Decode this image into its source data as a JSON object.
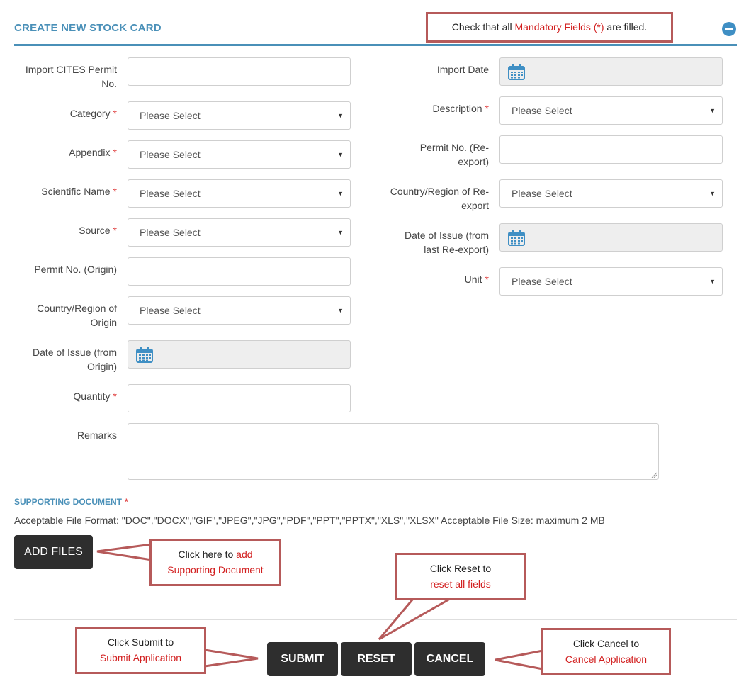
{
  "form": {
    "title": "CREATE NEW STOCK CARD",
    "required_mark": "*",
    "placeholder": "Please Select",
    "left_fields": {
      "import_permit": {
        "label_line1": "Import CITES Permit",
        "label_line2": "No."
      },
      "category": {
        "label": "Category"
      },
      "appendix": {
        "label": "Appendix"
      },
      "scientific_name": {
        "label": "Scientific Name"
      },
      "source": {
        "label": "Source"
      },
      "permit_origin": {
        "label": "Permit No. (Origin)"
      },
      "country_origin": {
        "label_line1": "Country/Region of",
        "label_line2": "Origin"
      },
      "date_issue_origin": {
        "label_line1": "Date of Issue (from",
        "label_line2": "Origin)"
      },
      "quantity": {
        "label": "Quantity"
      },
      "remarks": {
        "label": "Remarks"
      }
    },
    "right_fields": {
      "import_date": {
        "label": "Import Date"
      },
      "description": {
        "label": "Description"
      },
      "permit_reexport": {
        "label_line1": "Permit No. (Re-",
        "label_line2": "export)"
      },
      "country_reexport": {
        "label_line1": "Country/Region of Re-",
        "label_line2": "export"
      },
      "date_issue_reexport": {
        "label_line1": "Date of Issue (from",
        "label_line2": "last Re-export)"
      },
      "unit": {
        "label": "Unit"
      }
    }
  },
  "supporting": {
    "title": "SUPPORTING DOCUMENT",
    "note": "Acceptable File Format: \"DOC\",\"DOCX\",\"GIF\",\"JPEG\",\"JPG\",\"PDF\",\"PPT\",\"PPTX\",\"XLS\",\"XLSX\" Acceptable File Size: maximum 2 MB",
    "add_files_label": "ADD FILES"
  },
  "actions": {
    "submit": "SUBMIT",
    "reset": "RESET",
    "cancel": "CANCEL"
  },
  "callouts": {
    "mandatory": {
      "pre": "Check that all ",
      "red": "Mandatory Fields (*)",
      "post": " are filled."
    },
    "add": {
      "line1_pre": "Click here to ",
      "line1_red": "add",
      "line2_red": "Supporting Document"
    },
    "reset": {
      "line1": "Click Reset to",
      "line2_red": "reset all fields"
    },
    "submit": {
      "line1": "Click Submit to",
      "line2_red": "Submit Application"
    },
    "cancel": {
      "line1": "Click Cancel to",
      "line2_red": "Cancel Application"
    }
  },
  "colors": {
    "accent": "#4a90b8",
    "required": "#e04343",
    "callout_border": "#b65a5a",
    "button_dark": "#2e2e2e",
    "callout_text_red": "#d21f1f"
  },
  "icons": {
    "collapse": "minus-circle-icon",
    "calendar": "calendar-icon",
    "caret": "caret-down-icon"
  }
}
